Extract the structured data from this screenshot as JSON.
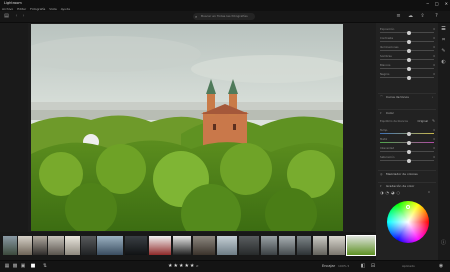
{
  "app": {
    "title": "Lightroom"
  },
  "menu": [
    "Archivo",
    "Editar",
    "Fotografía",
    "Vista",
    "Ayuda"
  ],
  "window_controls": [
    "─",
    "□",
    "✕"
  ],
  "search": {
    "placeholder": "Buscar en Todas las fotografías"
  },
  "edit_panel": {
    "sliders_top": [
      {
        "label": "Exposición",
        "value": "0"
      },
      {
        "label": "Contraste",
        "value": "0"
      },
      {
        "label": "Iluminaciones",
        "value": "0"
      },
      {
        "label": "Sombras",
        "value": "0"
      },
      {
        "label": "Blancos",
        "value": "0"
      },
      {
        "label": "Negros",
        "value": "0"
      }
    ],
    "curve_header": "Curva de tonos",
    "color_header": "Color",
    "color_sliders": [
      {
        "label": "Equilibrio de blancos",
        "value": "Original"
      },
      {
        "label": "Temp.",
        "value": "0"
      },
      {
        "label": "Matiz",
        "value": "0"
      },
      {
        "label": "Intensidad",
        "value": "0"
      },
      {
        "label": "Saturación",
        "value": "0"
      }
    ],
    "mixer_header": "Mezclador de colores",
    "grading_header": "Gradación de color",
    "grading_value": "0"
  },
  "bottom": {
    "stars": "★★★★★",
    "rating_label": "Ø",
    "save_label": "Encajar",
    "fit_label": "100% ▾",
    "info_label": "Aplicado"
  }
}
